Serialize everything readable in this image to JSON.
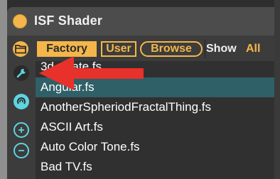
{
  "device": {
    "title": "ISF Shader",
    "power_icon": "power-toggle-icon"
  },
  "toolbar": {
    "folder_icon": "folder-icon",
    "tabs": [
      {
        "label": "Factory",
        "active": true
      },
      {
        "label": "User",
        "active": false
      },
      {
        "label": "Browse",
        "active": false
      }
    ],
    "show_label": "Show",
    "show_value": "All"
  },
  "sidebar": {
    "buttons": [
      "wrench-icon",
      "rotate-icon",
      "plus-icon",
      "minus-icon"
    ]
  },
  "file_list": {
    "items": [
      "3d-rotate.fs",
      "Angular.fs",
      "AnotherSpheriodFractalThing.fs",
      "ASCII Art.fs",
      "Auto Color Tone.fs",
      "Bad TV.fs"
    ],
    "selected_index": 1
  },
  "annotation": {
    "icon": "red-arrow-icon",
    "color": "#e8312a",
    "target": "wrench-button"
  },
  "colors": {
    "accent": "#f3b64a",
    "cyan": "#5ed4e0",
    "selection": "#2f5f67",
    "background": "#3c3c3c"
  }
}
